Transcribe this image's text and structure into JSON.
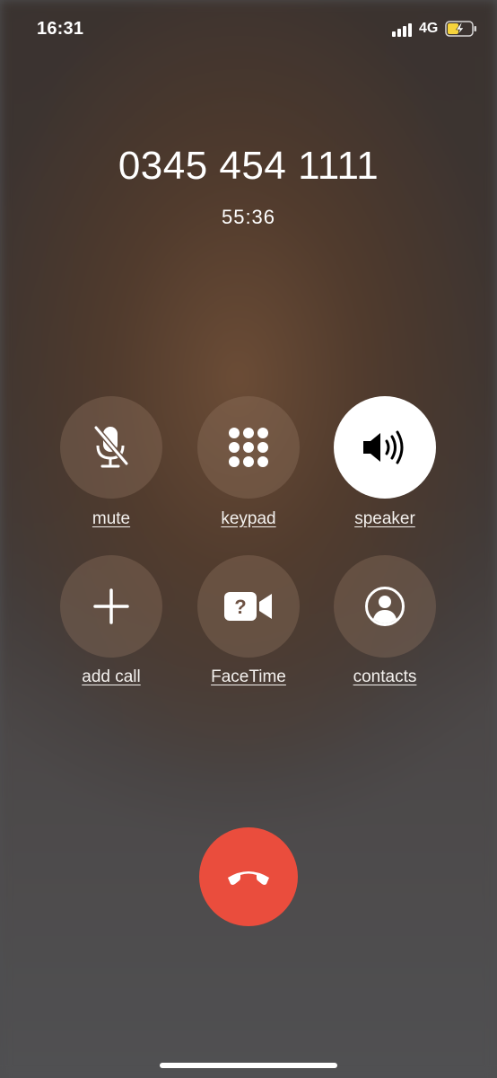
{
  "status_bar": {
    "time": "16:31",
    "network": "4G",
    "icons": [
      "signal-bars-icon",
      "battery-charging-icon"
    ]
  },
  "call": {
    "number": "0345 454 1111",
    "duration": "55:36"
  },
  "controls": {
    "mute": {
      "label": "mute",
      "icon": "mic-slash-icon",
      "active": false
    },
    "keypad": {
      "label": "keypad",
      "icon": "keypad-icon",
      "active": false
    },
    "speaker": {
      "label": "speaker",
      "icon": "speaker-icon",
      "active": true
    },
    "add_call": {
      "label": "add call",
      "icon": "plus-icon",
      "active": false
    },
    "facetime": {
      "label": "FaceTime",
      "icon": "facetime-video-icon",
      "active": false
    },
    "contacts": {
      "label": "contacts",
      "icon": "contact-icon",
      "active": false
    }
  },
  "end_call": {
    "icon": "end-call-icon"
  },
  "colors": {
    "end_call": "#ea4d3d",
    "active_button": "#ffffff",
    "battery_fill": "#f5d33c"
  }
}
